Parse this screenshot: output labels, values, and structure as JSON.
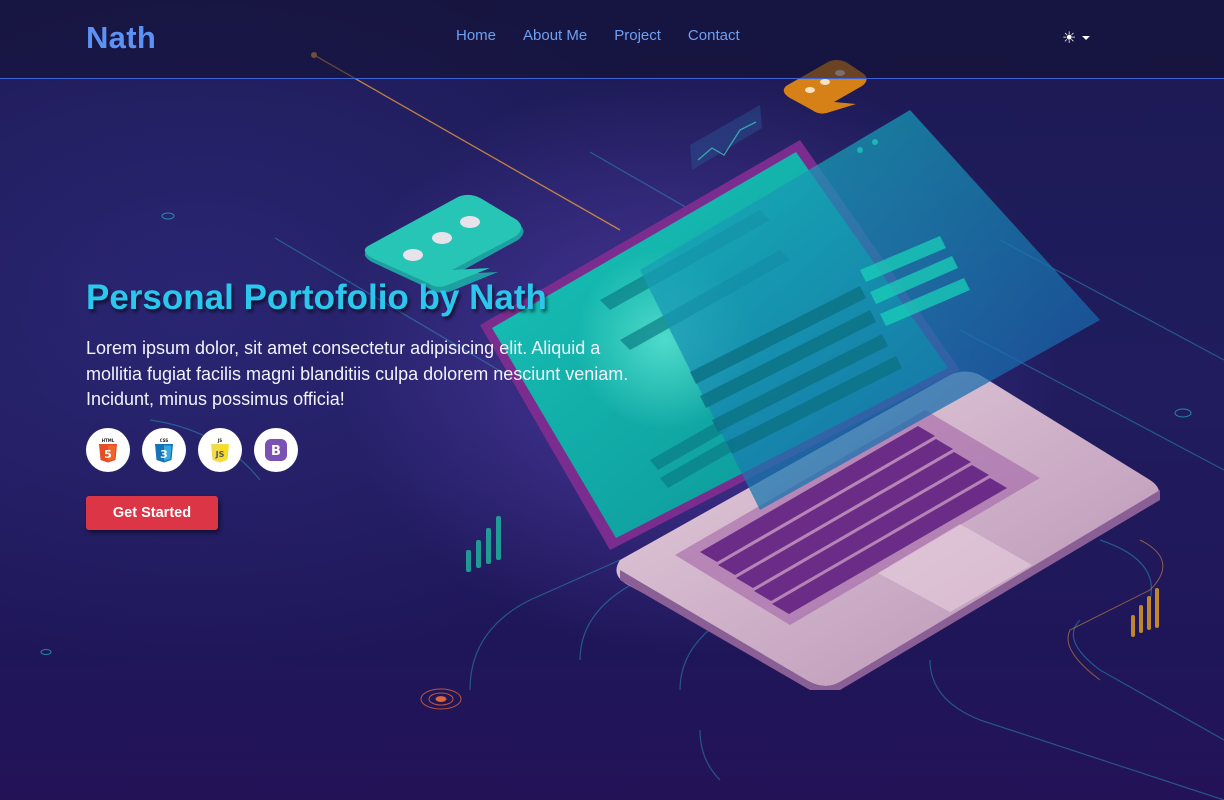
{
  "navbar": {
    "brand": "Nath",
    "links": [
      {
        "label": "Home"
      },
      {
        "label": "About Me"
      },
      {
        "label": "Project"
      },
      {
        "label": "Contact"
      }
    ],
    "theme_toggle": {
      "icon": "sun-icon"
    }
  },
  "hero": {
    "title": "Personal Portofolio by Nath",
    "description": "Lorem ipsum dolor, sit amet consectetur adipisicing elit. Aliquid a mollitia fugiat facilis magni blanditiis culpa dolorem nesciunt veniam. Incidunt, minus possimus officia!",
    "tech_icons": [
      {
        "name": "html5-icon",
        "label": "HTML",
        "glyph": "5",
        "color": "#e44d26"
      },
      {
        "name": "css3-icon",
        "label": "CSS",
        "glyph": "3",
        "color": "#1572b6"
      },
      {
        "name": "javascript-icon",
        "label": "JS",
        "glyph": "JS",
        "color": "#f0db4f"
      },
      {
        "name": "bootstrap-icon",
        "label": "",
        "glyph": "B",
        "color": "#7952b3"
      }
    ],
    "cta_label": "Get Started"
  },
  "colors": {
    "brand": "#5d92f5",
    "nav_link": "#6ea0f4",
    "title": "#2bc8ee",
    "cta": "#dc3545",
    "background": "#1c1a54"
  }
}
